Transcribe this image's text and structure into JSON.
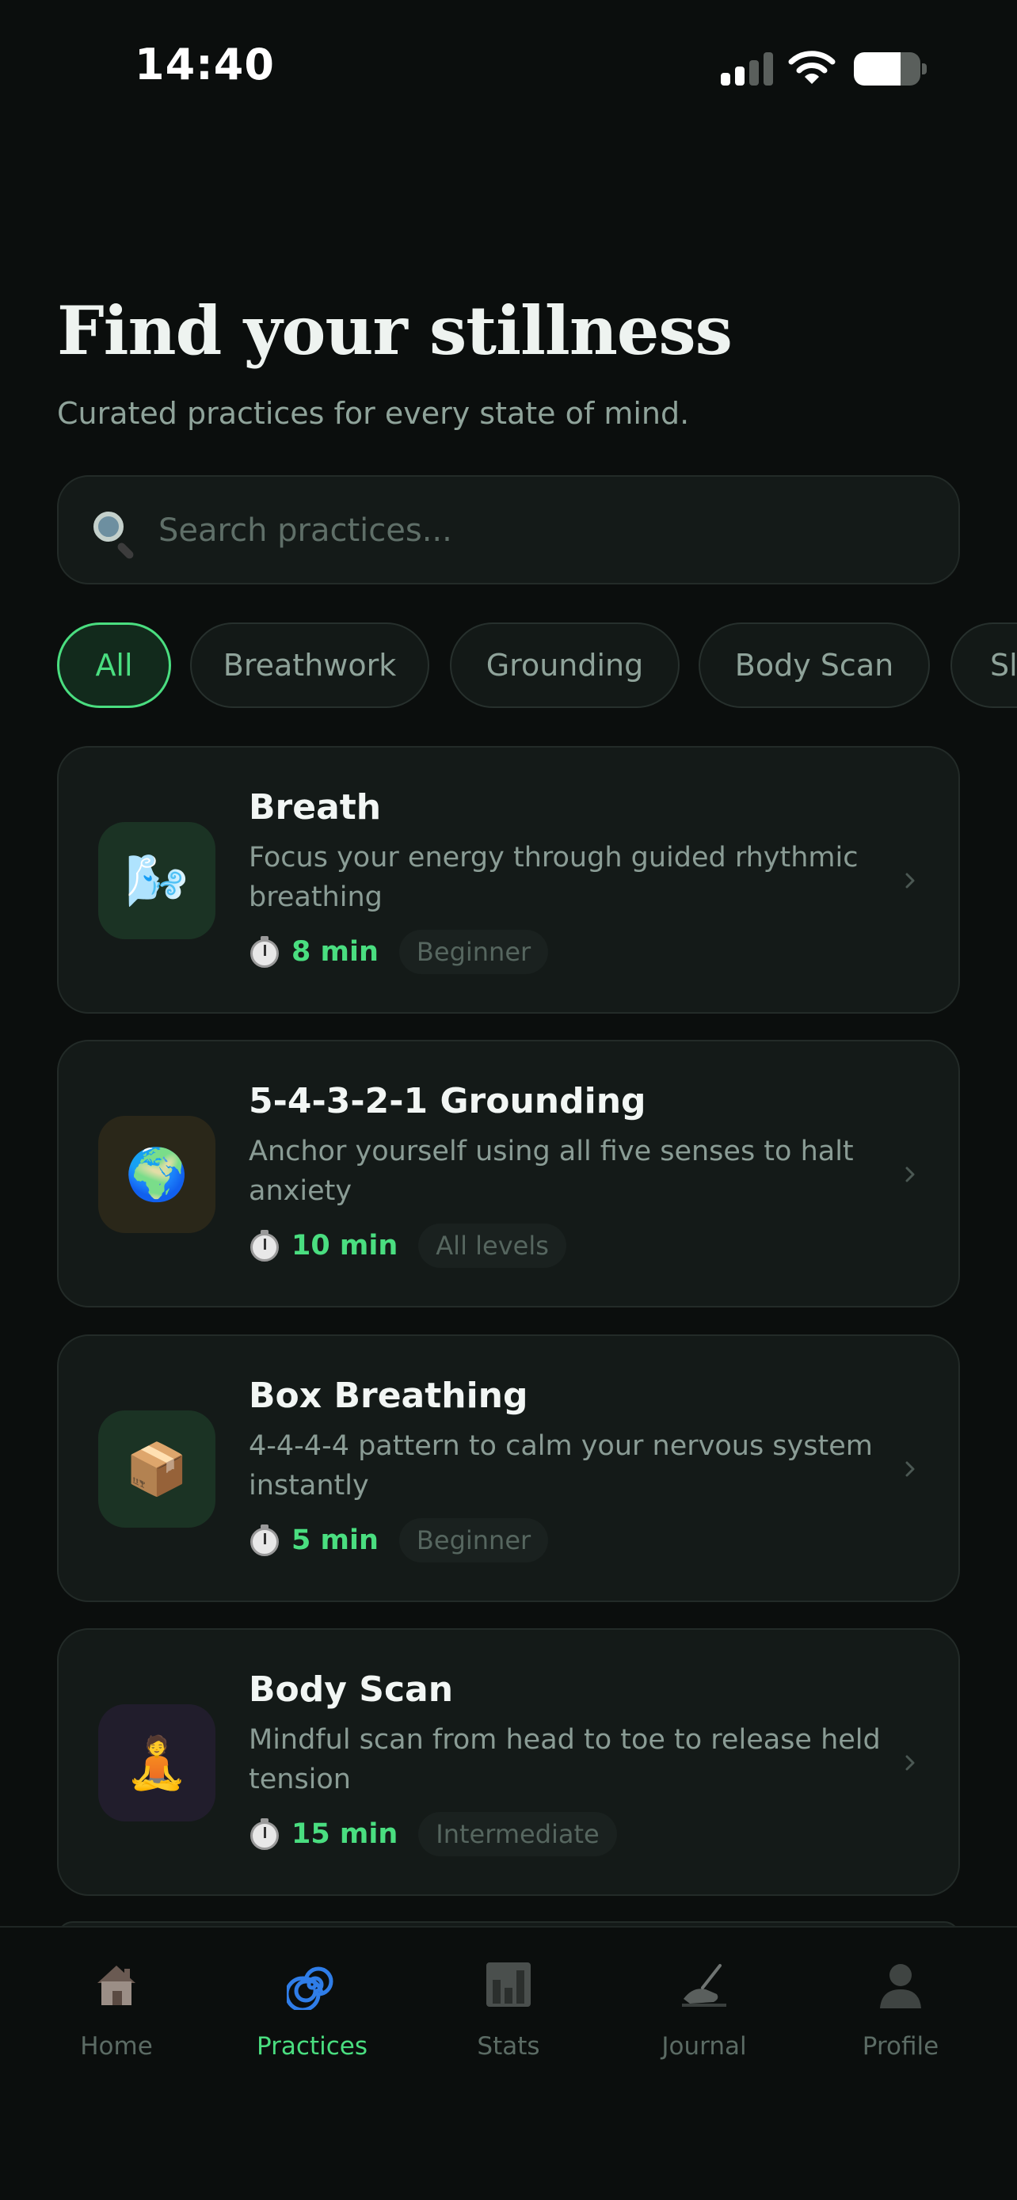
{
  "status_bar": {
    "time": "14:40",
    "signal_icon": "cellular-signal-icon",
    "wifi_icon": "wifi-icon",
    "battery_icon": "battery-icon",
    "battery_level": 0.7
  },
  "header": {
    "title": "Find your stillness",
    "subtitle": "Curated practices for every state of mind."
  },
  "search": {
    "icon": "search-icon",
    "placeholder": "Search practices...",
    "value": ""
  },
  "filters": {
    "selected": "All",
    "chips": [
      {
        "label": "All"
      },
      {
        "label": "Breathwork"
      },
      {
        "label": "Grounding"
      },
      {
        "label": "Body Scan"
      },
      {
        "label": "Sl"
      }
    ]
  },
  "practices": [
    {
      "title": "Breath",
      "description": "Focus your energy through guided rhythmic breathing",
      "duration": "8 min",
      "level": "Beginner",
      "icon": "face-exhaling-icon",
      "icon_glyph": "🌬️",
      "icon_bg": "#1b3324"
    },
    {
      "title": "5-4-3-2-1 Grounding",
      "description": "Anchor yourself using all five senses to halt anxiety",
      "duration": "10 min",
      "level": "All levels",
      "icon": "globe-icon",
      "icon_glyph": "🌍",
      "icon_bg": "#2a2719"
    },
    {
      "title": "Box Breathing",
      "description": "4-4-4-4 pattern to calm your nervous system instantly",
      "duration": "5 min",
      "level": "Beginner",
      "icon": "package-box-icon",
      "icon_glyph": "📦",
      "icon_bg": "#1b3324"
    },
    {
      "title": "Body Scan",
      "description": "Mindful scan from head to toe to release held tension",
      "duration": "15 min",
      "level": "Intermediate",
      "icon": "meditating-person-icon",
      "icon_glyph": "🧘",
      "icon_bg": "#211d2c"
    }
  ],
  "bottom_nav": {
    "active": "Practices",
    "items": [
      {
        "label": "Home",
        "icon": "house-icon"
      },
      {
        "label": "Practices",
        "icon": "spiral-icon"
      },
      {
        "label": "Stats",
        "icon": "bar-chart-icon"
      },
      {
        "label": "Journal",
        "icon": "writing-hand-icon"
      },
      {
        "label": "Profile",
        "icon": "person-silhouette-icon"
      }
    ]
  },
  "colors": {
    "background": "#0b0e0d",
    "card": "#141a18",
    "accent": "#4ade80",
    "muted_text": "#8a9c95"
  }
}
